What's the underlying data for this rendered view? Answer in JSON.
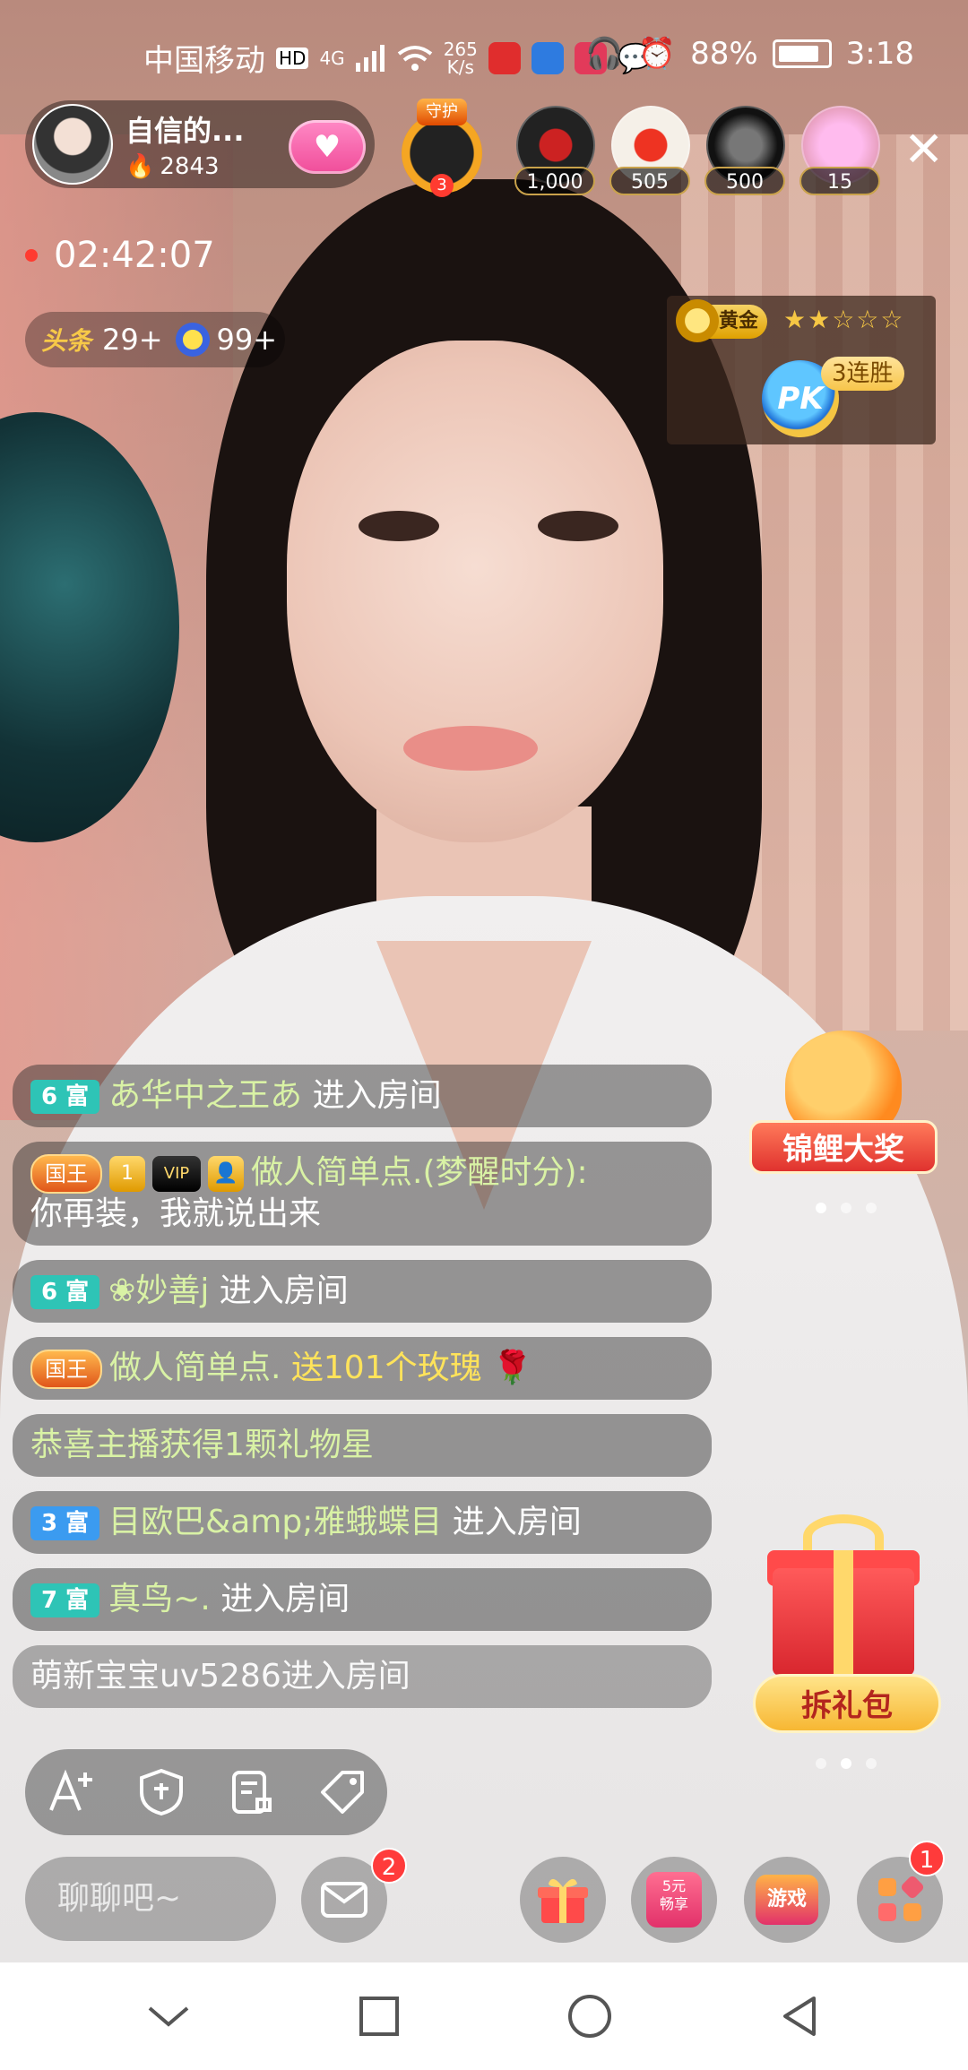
{
  "status_bar": {
    "carrier": "中国移动",
    "hd": "HD",
    "network": "4G",
    "speed_value": "265",
    "speed_unit": "K/s",
    "battery": "88%",
    "time": "3:18"
  },
  "host": {
    "name": "自信的...",
    "heat": "2843",
    "heat_icon": "flame-icon",
    "follow_icon": "heart-icon"
  },
  "guard": {
    "label": "守护",
    "level": "3"
  },
  "viewers": [
    {
      "count": "1,000"
    },
    {
      "count": "505"
    },
    {
      "count": "500"
    },
    {
      "count": "15"
    }
  ],
  "timer": "02:42:07",
  "ranks": {
    "headline_label": "头条",
    "headline_value": "29+",
    "star_value": "99+"
  },
  "pk": {
    "tier": "黄金",
    "stars": "★★☆☆☆",
    "button": "PK",
    "streak": "3连胜"
  },
  "chat": [
    {
      "level": "6 富",
      "name": "あ华中之王あ",
      "text": " 进入房间"
    },
    {
      "badge": "国王",
      "vip": "VIP",
      "name": "做人简单点.(梦醒时分):",
      "text": "你再装，我就说出来"
    },
    {
      "level": "6 富",
      "name": "❀妙善j",
      "text": " 进入房间"
    },
    {
      "badge": "国王",
      "name": "做人简单点.",
      "gift": " 送101个玫瑰",
      "gift_icon": "🌹"
    },
    {
      "system": "恭喜主播获得1颗礼物星"
    },
    {
      "level": "3 富",
      "name": "目欧巴&amp;雅蛾蝶目",
      "text": " 进入房间"
    },
    {
      "level": "7 富",
      "name": "真鸟~.",
      "text": " 进入房间"
    },
    {
      "plain": "萌新宝宝uv5286进入房间"
    }
  ],
  "promos": {
    "koi_label": "锦鲤大奖",
    "open_gift_label": "拆礼包"
  },
  "bottom": {
    "chat_placeholder": "聊聊吧~",
    "mail_badge": "2",
    "enjoy_label_1": "5元",
    "enjoy_label_2": "畅享",
    "game_label": "游戏",
    "more_badge": "1"
  },
  "colors": {
    "chat_name": "#d9f2a5",
    "gift_text": "#ffe35a",
    "badge_red": "#ff3b3b"
  }
}
